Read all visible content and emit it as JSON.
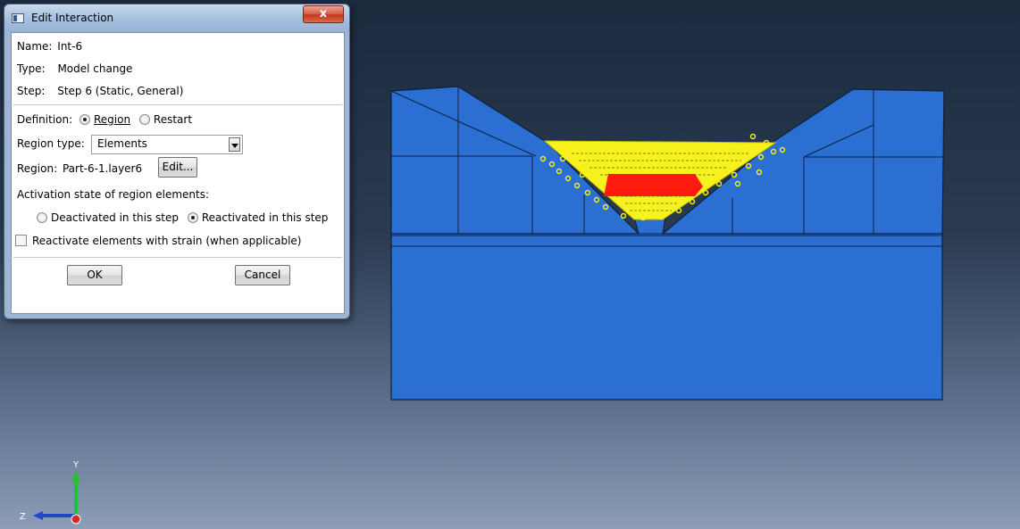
{
  "dialog": {
    "title": "Edit Interaction",
    "close_label": "x",
    "name_label": "Name:",
    "name_value": "Int-6",
    "type_label": "Type:",
    "type_value": "Model change",
    "step_label": "Step:",
    "step_value": "Step 6 (Static, General)",
    "definition_label": "Definition:",
    "definition_options": [
      {
        "label": "Region",
        "selected": true
      },
      {
        "label": "Restart",
        "selected": false
      }
    ],
    "region_type_label": "Region type:",
    "region_type_value": "Elements",
    "region_label": "Region:",
    "region_value": "Part-6-1.layer6",
    "edit_button": "Edit...",
    "activation_label": "Activation state of region elements:",
    "activation_options": [
      {
        "label": "Deactivated in this step",
        "selected": false
      },
      {
        "label": "Reactivated in this step",
        "selected": true
      }
    ],
    "strain_checkbox_label": "Reactivate elements with strain (when applicable)",
    "strain_checked": false,
    "ok_button": "OK",
    "cancel_button": "Cancel"
  },
  "triad": {
    "y_label": "Y",
    "z_label": "Z"
  },
  "colors": {
    "model_fill": "#2b6fd2",
    "mesh_line": "#0c1f3d",
    "highlight_yellow": "#f7f21e",
    "active_region_red": "#ff1a10"
  }
}
